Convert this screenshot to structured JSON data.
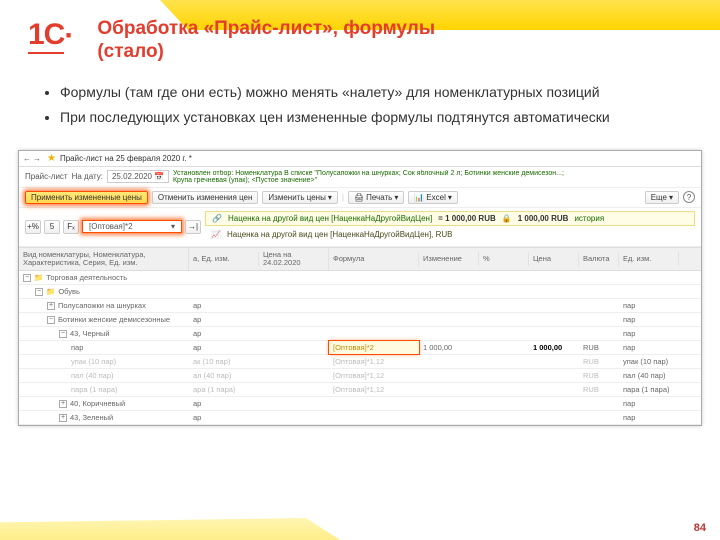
{
  "slide": {
    "title_line1": "Обработка «Прайс-лист», формулы",
    "title_line2": "(стало)",
    "logo": "1С",
    "bullets": [
      "Формулы (там где они есть) можно менять «налету» для номенклатурных позиций",
      "При последующих установках цен измененные формулы подтянутся автоматически"
    ],
    "page_num": "84"
  },
  "ss": {
    "tab_title": "Прайс-лист на 25 февраля 2020 г. *",
    "tb": {
      "pr_label": "Прайс-лист",
      "date_label": "На дату:",
      "date_value": "25.02.2020",
      "filter_text": "Установлен отбор: Номенклатура В списке \"Полусапожки на шнурках; Сок яблочный 2 л; Ботинки женские демисезон...; Крупа гречневая (упак); <Пустое значение>\"",
      "apply": "Применить измененные цены",
      "undo": "Отменить изменения цен",
      "change": "Изменить цены",
      "print": "Печать",
      "excel": "Excel",
      "more": "Еще",
      "fx": "Fₓ",
      "formula_input": "[Оптовая]*2"
    },
    "info1": {
      "label": "Наценка на другой вид цен [НаценкаНаДругойВидЦен]",
      "eq": "= 1 000,00 RUB",
      "lock": "1 000,00 RUB",
      "hist": "история"
    },
    "info2": {
      "label": "Наценка на другой вид цен [НаценкаНаДругойВидЦен], RUB"
    },
    "cols": {
      "c0": "Вид номенклатуры, Номенклатура, Характеристика, Серия, Ед. изм.",
      "c1": "а, Ед. изм.",
      "c2": "Цена на 24.02.2020",
      "c3": "Формула",
      "c4": "Изменение",
      "c5": "%",
      "c6": "Цена",
      "c7": "Валюта",
      "c8": "Ед. изм."
    },
    "rows": [
      {
        "indent": 0,
        "pm": "−",
        "folder": true,
        "name": "Торговая деятельность"
      },
      {
        "indent": 1,
        "pm": "−",
        "folder": true,
        "name": "Обувь"
      },
      {
        "indent": 2,
        "pm": "+",
        "folder": false,
        "name": "Полусапожки на шнурках",
        "c1": "ар",
        "c8": "пар"
      },
      {
        "indent": 2,
        "pm": "−",
        "folder": false,
        "name": "Ботинки женские демисезонные",
        "c1": "ар",
        "c8": "пар"
      },
      {
        "indent": 3,
        "pm": "−",
        "folder": false,
        "name": "43, Черный",
        "c1": "ар",
        "c8": "пар"
      },
      {
        "indent": 4,
        "pm": "",
        "folder": false,
        "name": "пар",
        "c1": "ар",
        "c3": "[Оптовая]*2",
        "c4": "1 000,00",
        "c6": "1 000,00",
        "c7": "RUB",
        "c8": "пар",
        "hl": true
      },
      {
        "indent": 4,
        "pm": "",
        "folder": false,
        "name": "упак (10 пар)",
        "c1": "ак (10 пар)",
        "c3": "[Оптовая]*1,12",
        "c7": "RUB",
        "c8": "упак (10 пар)",
        "muted": true
      },
      {
        "indent": 4,
        "pm": "",
        "folder": false,
        "name": "пал (40 пар)",
        "c1": "ал (40 пар)",
        "c3": "[Оптовая]*1,12",
        "c7": "RUB",
        "c8": "пал (40 пар)",
        "muted": true
      },
      {
        "indent": 4,
        "pm": "",
        "folder": false,
        "name": "пара (1 пара)",
        "c1": "ара (1 пара)",
        "c3": "[Оптовая]*1,12",
        "c7": "RUB",
        "c8": "пара (1 пара)",
        "muted": true
      },
      {
        "indent": 3,
        "pm": "+",
        "folder": false,
        "name": "40, Коричневый",
        "c1": "ар",
        "c8": "пар"
      },
      {
        "indent": 3,
        "pm": "+",
        "folder": false,
        "name": "43, Зеленый",
        "c1": "ар",
        "c8": "пар"
      }
    ]
  }
}
